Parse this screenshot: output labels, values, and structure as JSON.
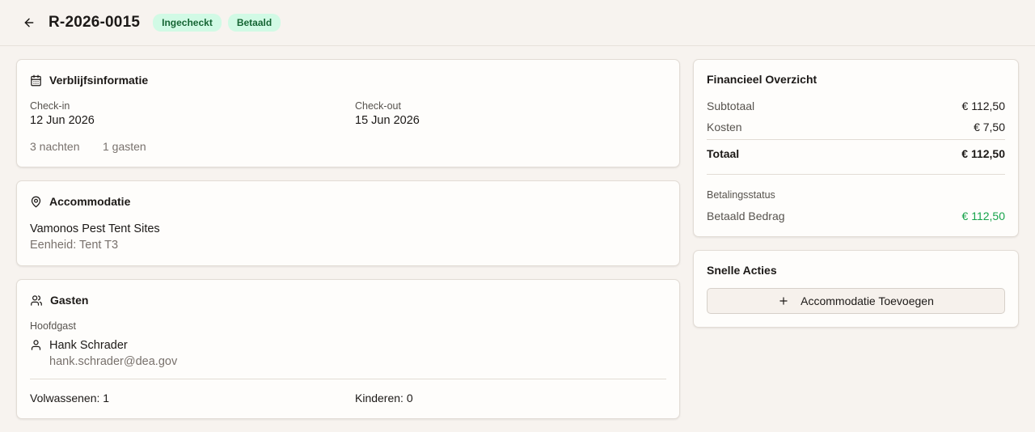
{
  "header": {
    "reservation_id": "R-2026-0015",
    "badges": [
      "Ingecheckt",
      "Betaald"
    ]
  },
  "stay": {
    "title": "Verblijfsinformatie",
    "checkin_label": "Check-in",
    "checkin_value": "12 Jun 2026",
    "checkout_label": "Check-out",
    "checkout_value": "15 Jun 2026",
    "nights": "3 nachten",
    "guests": "1 gasten"
  },
  "accommodation": {
    "title": "Accommodatie",
    "name": "Vamonos Pest Tent Sites",
    "unit": "Eenheid: Tent T3"
  },
  "guests": {
    "title": "Gasten",
    "main_guest_label": "Hoofdgast",
    "main_guest_name": "Hank Schrader",
    "main_guest_email": "hank.schrader@dea.gov",
    "adults": "Volwassenen: 1",
    "children": "Kinderen: 0"
  },
  "finance": {
    "title": "Financieel Overzicht",
    "subtotal_label": "Subtotaal",
    "subtotal_value": "€ 112,50",
    "fees_label": "Kosten",
    "fees_value": "€ 7,50",
    "total_label": "Totaal",
    "total_value": "€ 112,50",
    "payment_status_label": "Betalingsstatus",
    "paid_label": "Betaald Bedrag",
    "paid_value": "€ 112,50"
  },
  "quick_actions": {
    "title": "Snelle Acties",
    "add_accommodation": "Accommodatie Toevoegen"
  },
  "colors": {
    "background": "#f7f3ef",
    "badge_bg": "#d1fae5",
    "badge_text": "#166534",
    "paid_green": "#16a34a"
  }
}
